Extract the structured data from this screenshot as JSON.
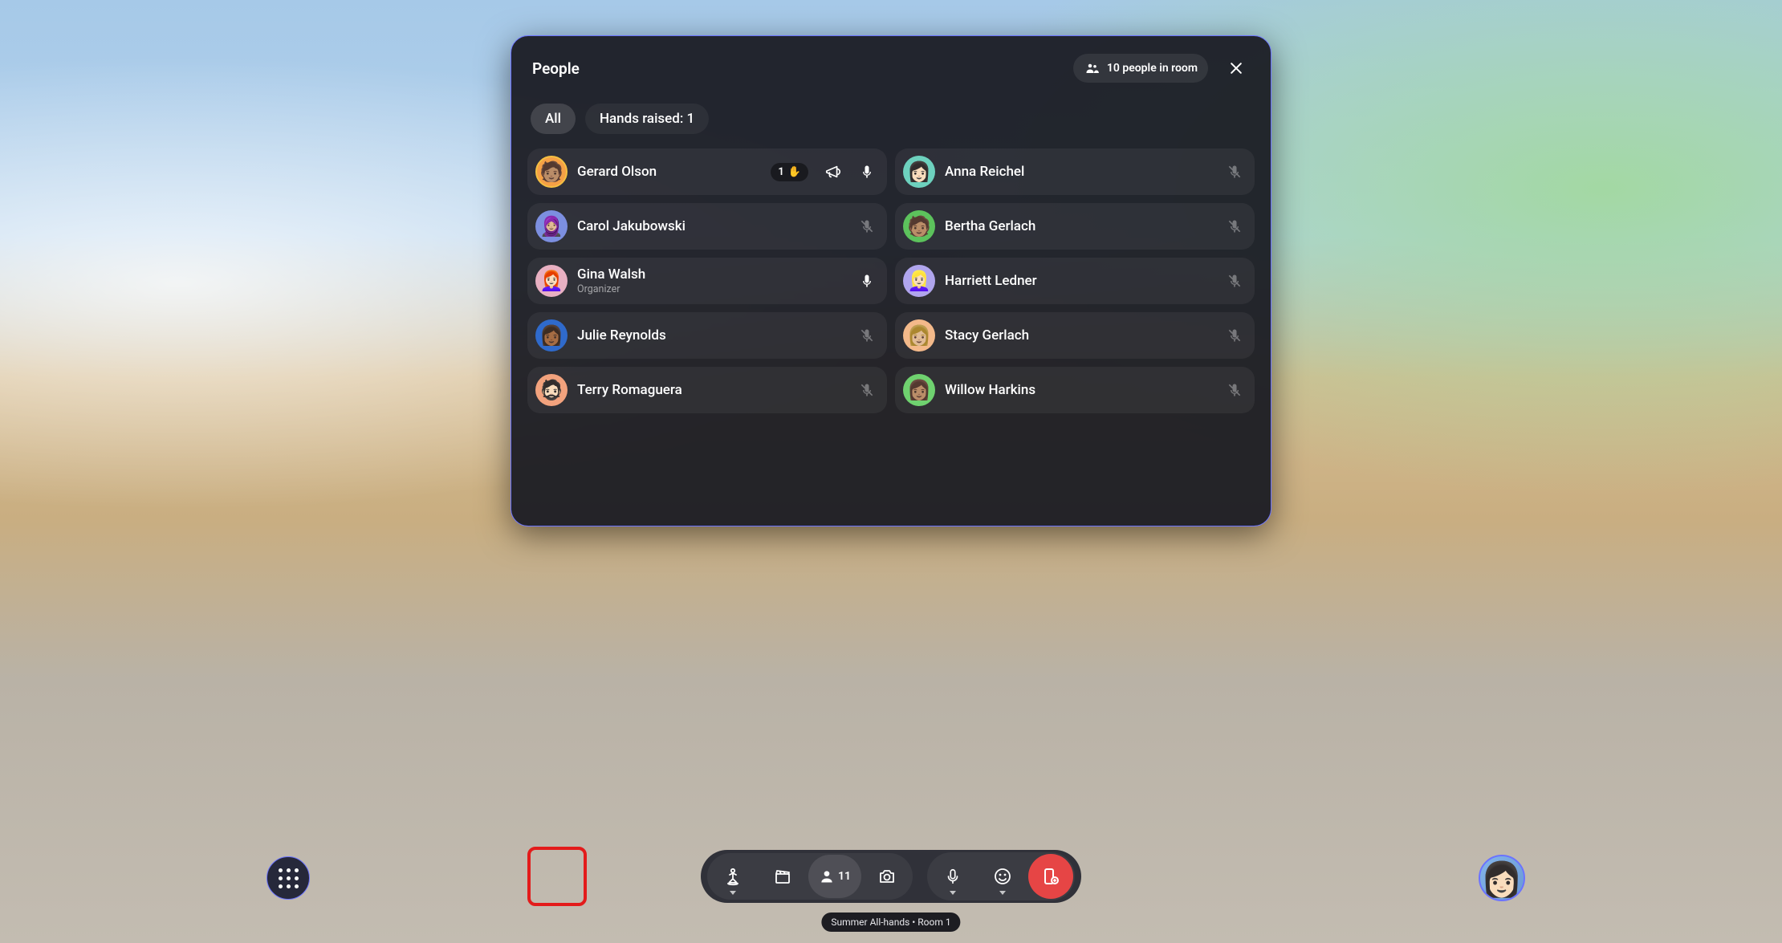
{
  "panel": {
    "title": "People",
    "room_count_label": "10 people in room",
    "chips": {
      "all": "All",
      "hands": "Hands raised: 1"
    }
  },
  "people_left": [
    {
      "name": "Gerard Olson",
      "sub": "",
      "hand_count": "1",
      "has_hand": true,
      "has_megaphone": true,
      "mic": "on",
      "avatar_bg": "#f5a046",
      "ring": "#f5c042"
    },
    {
      "name": "Carol Jakubowski",
      "sub": "",
      "mic": "muted",
      "avatar_bg": "#7c8fe0"
    },
    {
      "name": "Gina Walsh",
      "sub": "Organizer",
      "mic": "on",
      "avatar_bg": "#e8b0c2"
    },
    {
      "name": "Julie Reynolds",
      "sub": "",
      "mic": "muted",
      "avatar_bg": "#2f6acb"
    },
    {
      "name": "Terry Romaguera",
      "sub": "",
      "mic": "muted",
      "avatar_bg": "#f2a27d"
    }
  ],
  "people_right": [
    {
      "name": "Anna Reichel",
      "sub": "",
      "mic": "muted",
      "avatar_bg": "#6dd1be"
    },
    {
      "name": "Bertha Gerlach",
      "sub": "",
      "mic": "muted",
      "avatar_bg": "#5cc25c"
    },
    {
      "name": "Harriett Ledner",
      "sub": "",
      "mic": "muted",
      "avatar_bg": "#b0a5ed"
    },
    {
      "name": "Stacy Gerlach",
      "sub": "",
      "mic": "muted",
      "avatar_bg": "#f3b98a"
    },
    {
      "name": "Willow Harkins",
      "sub": "",
      "mic": "muted",
      "avatar_bg": "#6fd26f"
    }
  ],
  "toolbar": {
    "people_count": "11"
  },
  "tooltip": "Summer All-hands • Room 1"
}
